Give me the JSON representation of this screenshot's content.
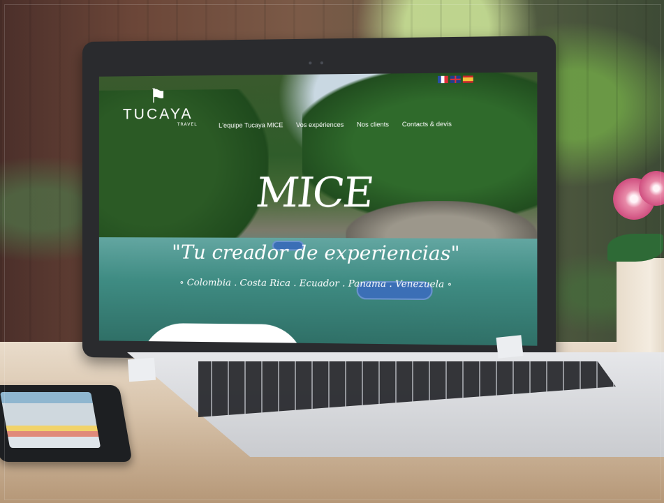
{
  "site": {
    "logo": {
      "name": "TUCAYA",
      "sub": "TRAVEL"
    },
    "languages": [
      "fr-flag-icon",
      "uk-flag-icon",
      "es-flag-icon"
    ],
    "nav": [
      {
        "label": "L'equipe Tucaya MICE"
      },
      {
        "label": "Vos expériences"
      },
      {
        "label": "Nos clients"
      },
      {
        "label": "Contacts & devis"
      }
    ],
    "hero": {
      "title": "MICE",
      "subtitle": "\"Tu creador de experiencias\"",
      "countries": "∘ Colombia . Costa Rica . Ecuador . Panama . Venezuela ∘"
    }
  },
  "colors": {
    "text": "#ffffff",
    "laptop_frame": "#2a2b2e",
    "laptop_body": "#d6d8dc"
  }
}
